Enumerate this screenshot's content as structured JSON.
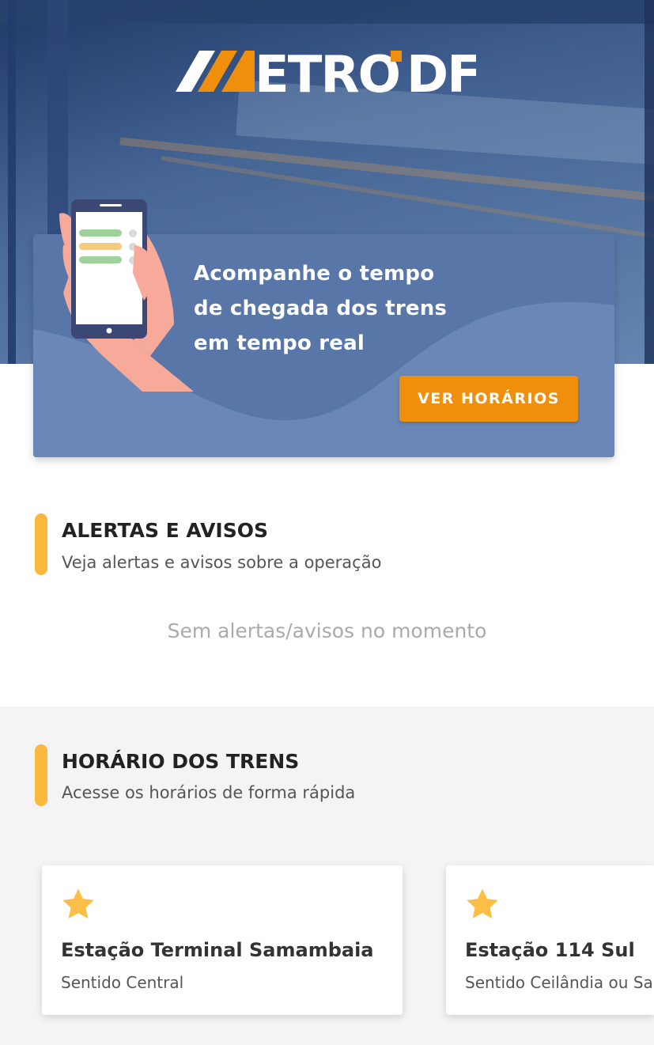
{
  "brand": {
    "logo_text": "METRO DF"
  },
  "promo": {
    "line1": "Acompanhe o tempo",
    "line2": "de chegada dos trens",
    "line3": "em tempo real",
    "button_label": "VER HORÁRIOS"
  },
  "alerts": {
    "title": "ALERTAS E AVISOS",
    "subtitle": "Veja alertas e avisos sobre a operação",
    "empty_message": "Sem alertas/avisos no momento"
  },
  "schedules": {
    "title": "HORÁRIO DOS TRENS",
    "subtitle": "Acesse os horários de forma rápida",
    "stations": [
      {
        "name": "Estação Terminal Samambaia",
        "direction": "Sentido Central",
        "icon": "star-icon"
      },
      {
        "name": "Estação 114 Sul",
        "direction": "Sentido Ceilândia ou Samambaia",
        "icon": "star-icon"
      }
    ]
  },
  "colors": {
    "accent_orange": "#f08f0c",
    "section_bar_yellow": "#fbb83f",
    "promo_blue": "#5876a8",
    "star_yellow": "#fbbf47"
  }
}
